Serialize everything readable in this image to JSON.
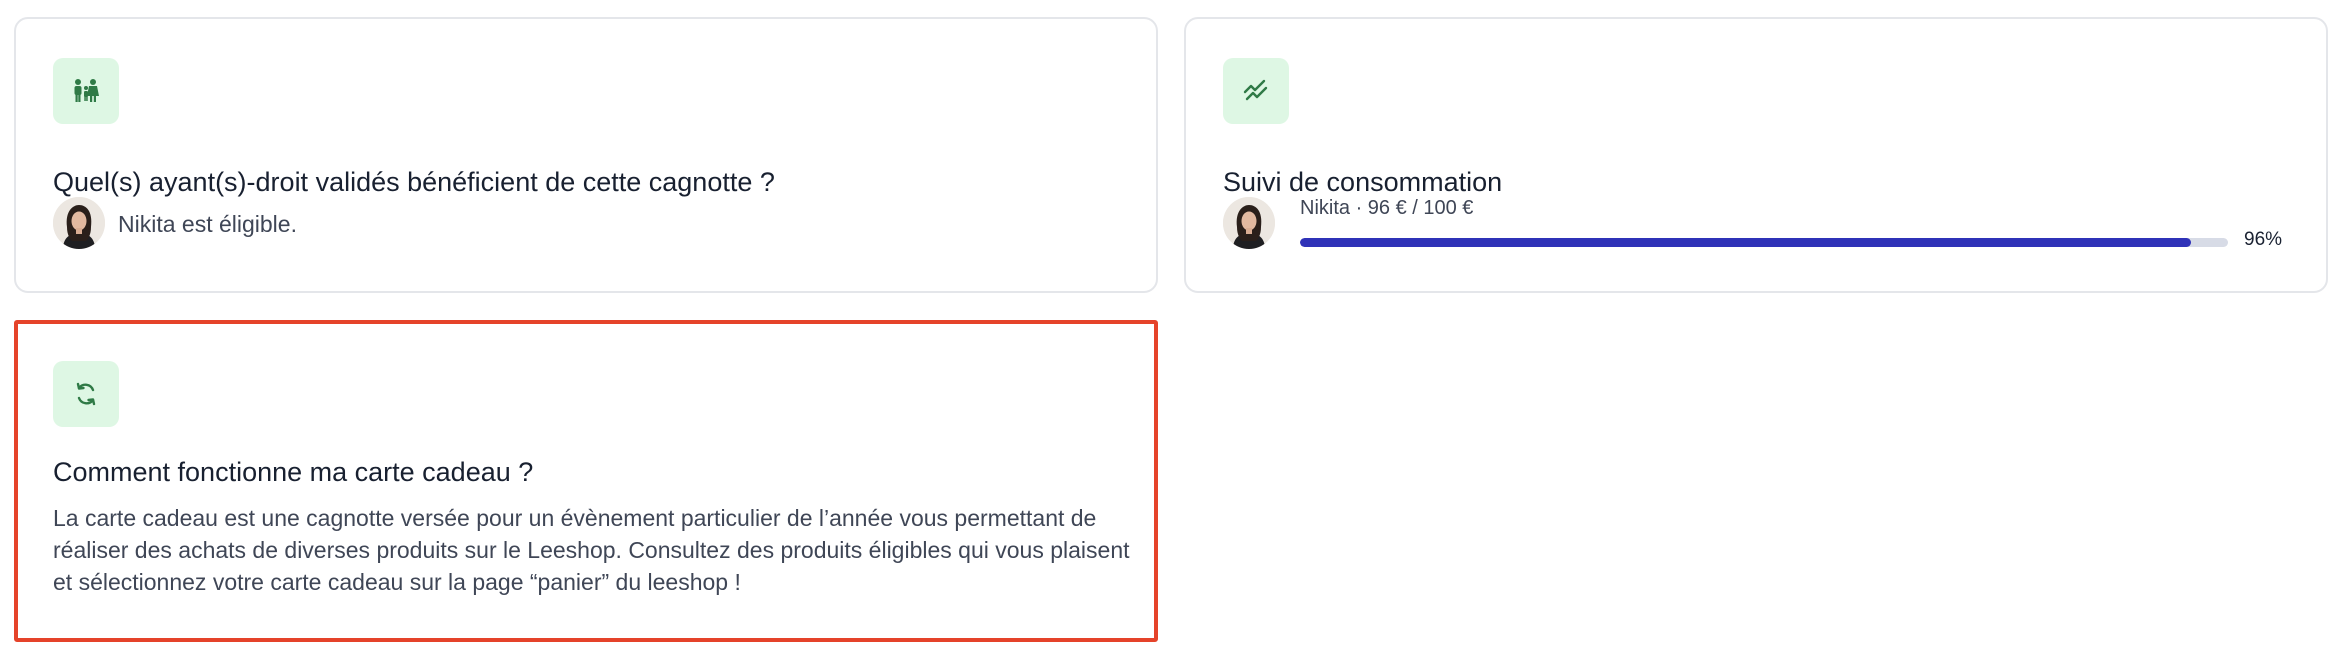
{
  "cards": {
    "eligibility": {
      "icon": "family-icon",
      "title": "Quel(s) ayant(s)-droit validés bénéficient de cette cagnotte ?",
      "beneficiary_text": "Nikita est éligible."
    },
    "consumption": {
      "icon": "trend-chart-icon",
      "title": "Suivi de consommation",
      "entry_label": "Nikita · 96 € / 100 €",
      "progress_fraction": 0.96,
      "progress_percent": "96%"
    },
    "gift_card": {
      "icon": "refresh-icon",
      "title": "Comment fonctionne ma carte cadeau ?",
      "description": "La carte cadeau est une cagnotte versée pour un évènement particulier de l’année vous permettant de réaliser des achats de diverses produits sur le Leeshop. Consultez des produits éligibles qui vous plaisent et sélectionnez votre carte cadeau sur la page “panier” du leeshop !"
    }
  },
  "colors": {
    "icon_background": "#def7e4",
    "icon_stroke": "#2f7a46",
    "progress_fill": "#2f32b8",
    "progress_track": "#d7dbe6",
    "highlight_border": "#e5432a"
  }
}
